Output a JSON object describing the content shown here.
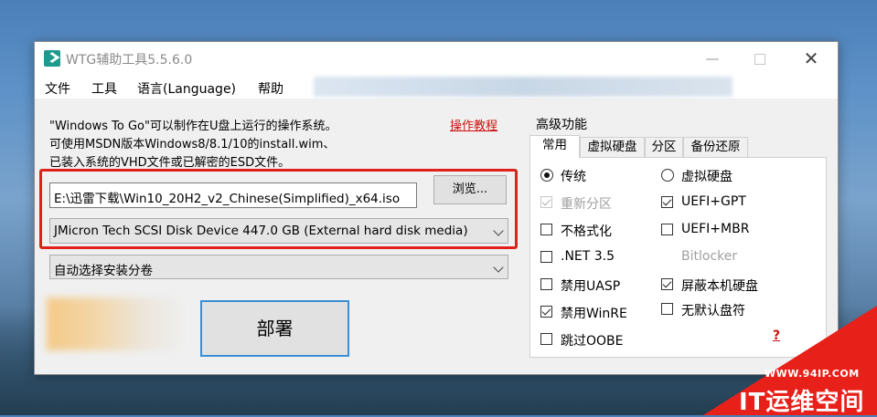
{
  "window": {
    "title": "WTG辅助工具5.5.6.0"
  },
  "title_controls": {
    "minimize": "—",
    "close": "✕"
  },
  "menu": [
    "文件",
    "工具",
    "语言(Language)",
    "帮助"
  ],
  "description": [
    "\"Windows To Go\"可以制作在U盘上运行的操作系统。",
    "可使用MSDN版本Windows8/8.1/10的install.wim、",
    "已装入系统的VHD文件或已解密的ESD文件。"
  ],
  "tutorial_link": "操作教程",
  "image_path": {
    "value": "E:\\迅雷下载\\Win10_20H2_v2_Chinese(Simplified)_x64.iso"
  },
  "browse_label": "浏览...",
  "disk_select": {
    "value": "JMicron Tech SCSI Disk Device 447.0 GB (External hard disk media)"
  },
  "volume_select": {
    "value": "自动选择安装分卷"
  },
  "deploy_label": "部署",
  "advanced": {
    "title": "高级功能",
    "tabs": [
      "常用",
      "虚拟硬盘",
      "分区",
      "备份还原"
    ],
    "active_tab": "常用",
    "options": {
      "legacy": {
        "label": "传统",
        "selected": true
      },
      "vhd": {
        "label": "虚拟硬盘",
        "selected": false
      },
      "repartition": {
        "label": "重新分区",
        "checked": true,
        "disabled": true
      },
      "uefi_gpt": {
        "label": "UEFI+GPT",
        "checked": true
      },
      "no_format": {
        "label": "不格式化",
        "checked": false
      },
      "uefi_mbr": {
        "label": "UEFI+MBR",
        "checked": false
      },
      "net35": {
        "label": ".NET 3.5",
        "checked": false
      },
      "bitlocker": {
        "label": "Bitlocker",
        "checked": false,
        "disabled": true
      },
      "disable_uasp": {
        "label": "禁用UASP",
        "checked": false
      },
      "hide_local_disk": {
        "label": "屏蔽本机硬盘",
        "checked": true
      },
      "disable_winre": {
        "label": "禁用WinRE",
        "checked": true
      },
      "no_drive_letter": {
        "label": "无默认盘符",
        "checked": false
      },
      "skip_oobe": {
        "label": "跳过OOBE",
        "checked": false
      }
    },
    "help": "?"
  },
  "watermark": {
    "url": "WWW.94IP.COM",
    "brand": "IT运维空间"
  },
  "colors": {
    "accent": "#3a8fd6",
    "highlight_frame": "#e0201c",
    "link": "#d01010"
  }
}
